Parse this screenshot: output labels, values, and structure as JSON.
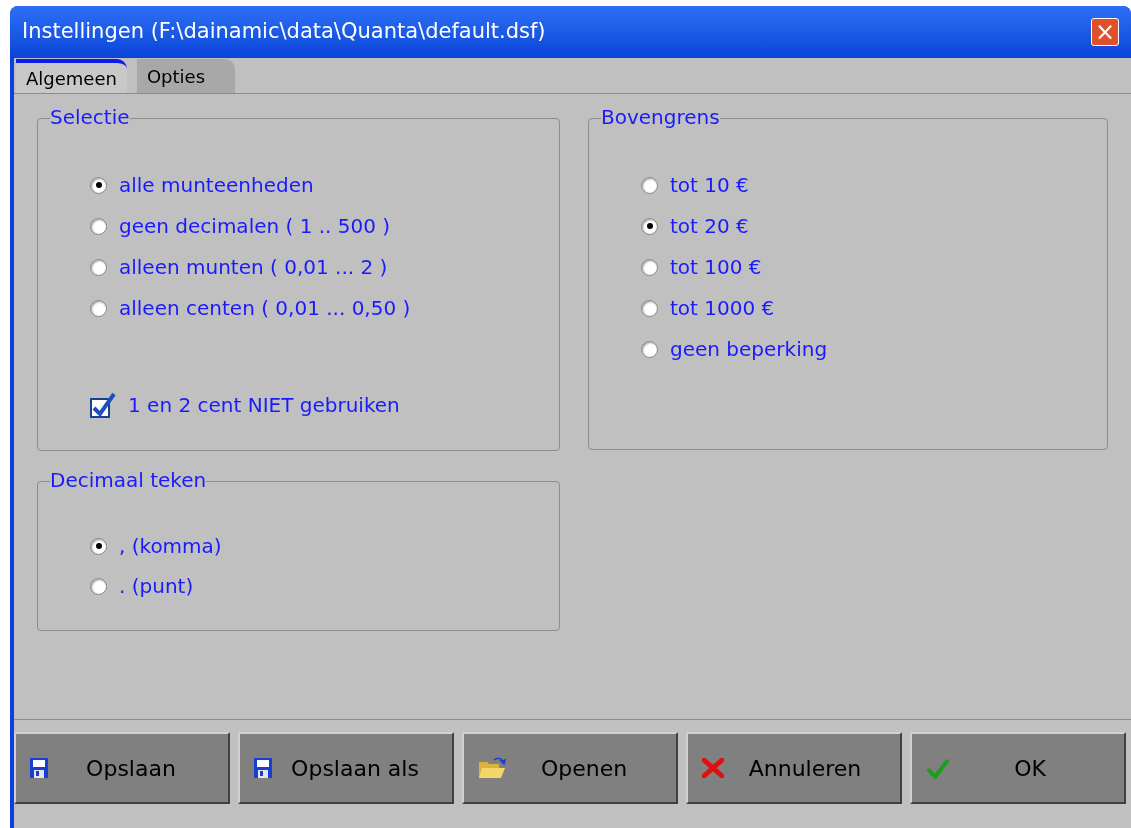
{
  "window": {
    "title": "Instellingen (F:\\dainamic\\data\\Quanta\\default.dsf)",
    "close": "×"
  },
  "tabs": [
    {
      "label": "Algemeen",
      "selected": true
    },
    {
      "label": "Opties",
      "selected": false
    }
  ],
  "selectie": {
    "title": "Selectie",
    "options": [
      {
        "label": "alle munteenheden",
        "selected": true
      },
      {
        "label": "geen decimalen ( 1 .. 500 )",
        "selected": false
      },
      {
        "label": "alleen munten ( 0,01 ... 2 )",
        "selected": false
      },
      {
        "label": "alleen centen ( 0,01 ... 0,50 )",
        "selected": false
      }
    ],
    "checkbox": {
      "label": "1 en 2 cent NIET gebruiken",
      "checked": true
    }
  },
  "bovengrens": {
    "title": "Bovengrens",
    "options": [
      {
        "label": "tot 10 €",
        "selected": false
      },
      {
        "label": "tot 20 €",
        "selected": true
      },
      {
        "label": "tot 100 €",
        "selected": false
      },
      {
        "label": "tot 1000 €",
        "selected": false
      },
      {
        "label": "geen beperking",
        "selected": false
      }
    ]
  },
  "decimaal_teken": {
    "title": "Decimaal teken",
    "options": [
      {
        "label": ", (komma)",
        "selected": true
      },
      {
        "label": ". (punt)",
        "selected": false
      }
    ]
  },
  "buttons": [
    {
      "label": "Opslaan",
      "kind": "save"
    },
    {
      "label": "Opslaan als",
      "kind": "save"
    },
    {
      "label": "Openen",
      "kind": "open"
    },
    {
      "label": "Annuleren",
      "kind": "cancel"
    },
    {
      "label": "OK",
      "kind": "ok"
    }
  ]
}
